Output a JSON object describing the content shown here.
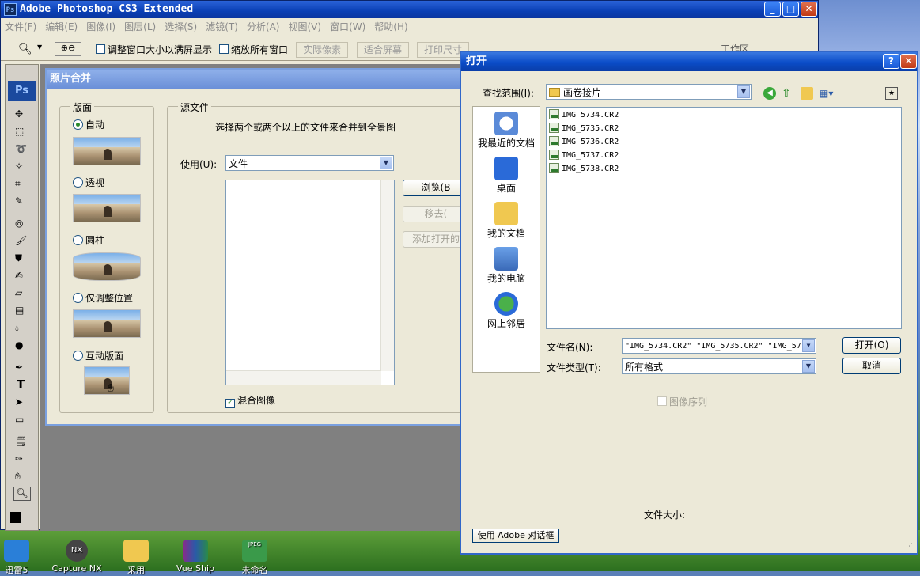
{
  "photoshop": {
    "title": "Adobe Photoshop CS3 Extended",
    "menu": [
      "文件(F)",
      "编辑(E)",
      "图像(I)",
      "图层(L)",
      "选择(S)",
      "滤镜(T)",
      "分析(A)",
      "视图(V)",
      "窗口(W)",
      "帮助(H)"
    ],
    "options": {
      "resize_windows": "调整窗口大小以满屏显示",
      "zoom_all": "缩放所有窗口",
      "actual_pixels": "实际像素",
      "fit_screen": "适合屏幕",
      "print_size": "打印尺寸",
      "workspace": "工作区"
    }
  },
  "photomerge": {
    "title": "照片合并",
    "layout_group": "版面",
    "layouts": [
      {
        "label": "自动",
        "selected": true
      },
      {
        "label": "透视",
        "selected": false
      },
      {
        "label": "圆柱",
        "selected": false
      },
      {
        "label": "仅调整位置",
        "selected": false
      },
      {
        "label": "互动版面",
        "selected": false
      }
    ],
    "source_group": "源文件",
    "source_desc": "选择两个或两个以上的文件来合并到全景图",
    "use_label": "使用(U):",
    "use_value": "文件",
    "browse": "浏览(B",
    "remove": "移去(",
    "add_open": "添加打开的",
    "blend_images": "混合图像",
    "blend_checked": true
  },
  "open_dialog": {
    "title": "打开",
    "look_in_label": "查找范围(I):",
    "look_in_value": "画卷接片",
    "places": [
      {
        "label": "我最近的文档",
        "icon": "recent-docs-icon"
      },
      {
        "label": "桌面",
        "icon": "desktop-icon"
      },
      {
        "label": "我的文档",
        "icon": "my-documents-icon"
      },
      {
        "label": "我的电脑",
        "icon": "my-computer-icon"
      },
      {
        "label": "网上邻居",
        "icon": "network-icon"
      }
    ],
    "files": [
      "IMG_5734.CR2",
      "IMG_5735.CR2",
      "IMG_5736.CR2",
      "IMG_5737.CR2",
      "IMG_5738.CR2"
    ],
    "filename_label": "文件名(N):",
    "filename_value": "\"IMG_5734.CR2\" \"IMG_5735.CR2\" \"IMG_57:",
    "filetype_label": "文件类型(T):",
    "filetype_value": "所有格式",
    "open_button": "打开(O)",
    "cancel_button": "取消",
    "image_sequence": "图像序列",
    "file_size": "文件大小:",
    "use_adobe_dialog": "使用 Adobe 对话框"
  },
  "desktop_icons": [
    "迅雷5",
    "Capture NX",
    "采用",
    "Vue Ship",
    "未命名"
  ]
}
